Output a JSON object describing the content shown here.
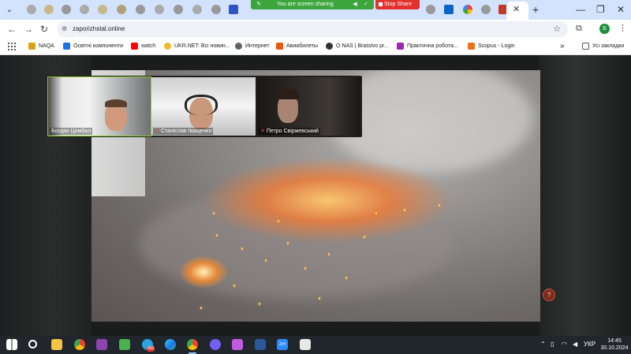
{
  "browser": {
    "url": "zaporizhstal.online",
    "profile_initial": "Б"
  },
  "screen_share": {
    "status_text": "You are screen sharing",
    "stop_label": "Stop Share"
  },
  "bookmarks": {
    "items": [
      {
        "label": "NAQA",
        "color": "#d6a317"
      },
      {
        "label": "Освітні компоненти",
        "color": "#1a73e8"
      },
      {
        "label": "watch",
        "color": "#ff0000"
      },
      {
        "label": "UKR.NET: Всі новин...",
        "color": "#f2b92c"
      },
      {
        "label": "Интернет",
        "color": "#5f6368"
      },
      {
        "label": "Авиабилеты",
        "color": "#e8590c"
      },
      {
        "label": "О NAS | Bratstvo pr...",
        "color": "#333333"
      },
      {
        "label": "Практична робота...",
        "color": "#9c27b0"
      },
      {
        "label": "Scopus - Login",
        "color": "#e9711c"
      }
    ],
    "other_label": "Усі закладки"
  },
  "participants": [
    {
      "name": "Богдан Цимбал",
      "mic_muted": false,
      "active": true
    },
    {
      "name": "Станіслав Іващенко",
      "mic_muted": true,
      "active": false
    },
    {
      "name": "Петро Свіржевський",
      "mic_muted": true,
      "active": false
    }
  ],
  "help_button": {
    "label": "?"
  },
  "taskbar": {
    "telegram_badge": "493",
    "zoom_label": "zm",
    "language": "УКР",
    "time": "14:45",
    "date": "30.10.2024"
  }
}
